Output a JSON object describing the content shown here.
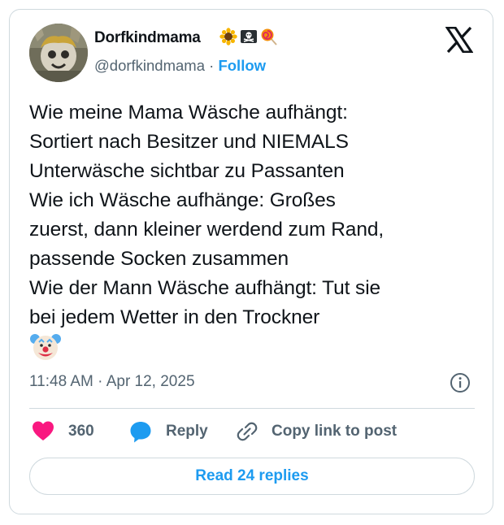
{
  "author": {
    "display_name": "Dorfkindmama",
    "name_emojis": [
      "sunflower-icon",
      "skull-crossbones-flag-icon",
      "lollipop-icon"
    ],
    "handle": "@dorfkindmama",
    "separator": "·",
    "follow_label": "Follow"
  },
  "platform_logo": "x-logo-icon",
  "tweet": {
    "text": "Wie meine Mama Wäsche aufhängt:\nSortiert nach Besitzer und NIEMALS\nUnterwäsche sichtbar zu Passanten\nWie ich Wäsche aufhänge: Großes\nzuerst, dann kleiner werdend zum Rand,\npassende Socken zusammen\nWie der Mann Wäsche aufhängt: Tut sie\nbei jedem Wetter in den Trockner",
    "trailing_emoji": "clown-face-icon",
    "timestamp": "11:48 AM · Apr 12, 2025"
  },
  "actions": {
    "like_count": "360",
    "reply_label": "Reply",
    "copy_link_label": "Copy link to post"
  },
  "read_replies_label": "Read 24 replies",
  "colors": {
    "accent": "#1d9bf0",
    "like": "#f91880",
    "text": "#0f1419",
    "muted": "#536471",
    "border": "#cfd9de"
  }
}
